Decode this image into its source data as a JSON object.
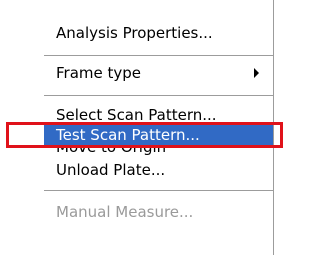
{
  "menu": {
    "items": [
      {
        "label": "Analysis Properties...",
        "state": "enabled"
      },
      {
        "label": "Frame type",
        "state": "enabled",
        "has_submenu": true,
        "submenu_icon": "chevron-right-icon"
      },
      {
        "label": "Select Scan Pattern...",
        "state": "enabled",
        "partially_hidden": true
      },
      {
        "label": "Test Scan Pattern...",
        "state": "highlighted"
      },
      {
        "label": "Move to Origin",
        "state": "enabled",
        "partially_hidden": true
      },
      {
        "label": "Unload Plate...",
        "state": "enabled"
      },
      {
        "label": "Manual Measure...",
        "state": "disabled"
      }
    ]
  },
  "colors": {
    "highlight": "#316ac5",
    "highlight_text": "#ffffff",
    "disabled_text": "#9a9a9a",
    "annotation": "#e0121a"
  }
}
